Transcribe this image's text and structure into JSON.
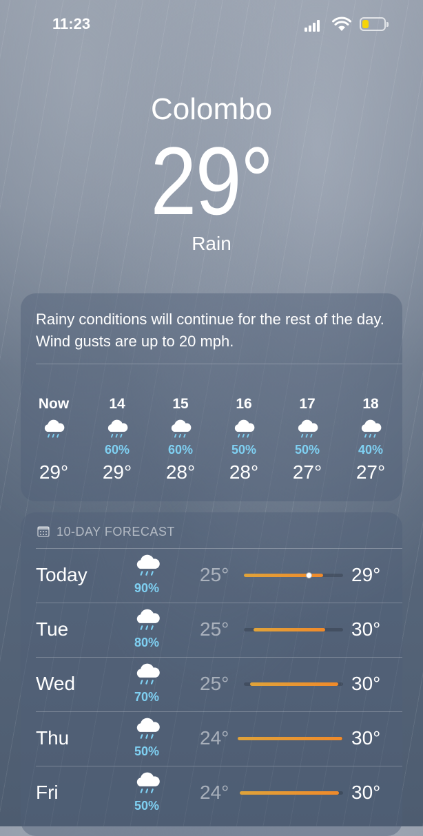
{
  "status_bar": {
    "time": "11:23"
  },
  "header": {
    "city": "Colombo",
    "temperature": "29°",
    "condition": "Rain"
  },
  "summary": {
    "text": "Rainy conditions will continue for the rest of the day. Wind gusts are up to 20 mph."
  },
  "hourly": [
    {
      "label": "Now",
      "icon": "rain-cloud-icon",
      "precip": "",
      "temp": "29°"
    },
    {
      "label": "14",
      "icon": "rain-cloud-icon",
      "precip": "60%",
      "temp": "29°"
    },
    {
      "label": "15",
      "icon": "rain-cloud-icon",
      "precip": "60%",
      "temp": "28°"
    },
    {
      "label": "16",
      "icon": "rain-cloud-icon",
      "precip": "50%",
      "temp": "28°"
    },
    {
      "label": "17",
      "icon": "rain-cloud-icon",
      "precip": "50%",
      "temp": "27°"
    },
    {
      "label": "18",
      "icon": "rain-cloud-icon",
      "precip": "40%",
      "temp": "27°"
    }
  ],
  "forecast": {
    "title": "10-DAY FORECAST",
    "days": [
      {
        "day": "Today",
        "icon": "rain-cloud-icon",
        "precip": "90%",
        "low": "25°",
        "high": "29°",
        "range_start": 0.0,
        "range_end": 0.8,
        "current_marker": 0.65
      },
      {
        "day": "Tue",
        "icon": "rain-cloud-icon",
        "precip": "80%",
        "low": "25°",
        "high": "30°",
        "range_start": 0.1,
        "range_end": 0.82
      },
      {
        "day": "Wed",
        "icon": "rain-cloud-icon",
        "precip": "70%",
        "low": "25°",
        "high": "30°",
        "range_start": 0.06,
        "range_end": 0.95
      },
      {
        "day": "Thu",
        "icon": "rain-cloud-icon",
        "precip": "50%",
        "low": "24°",
        "high": "30°",
        "range_start": -0.06,
        "range_end": 0.99
      },
      {
        "day": "Fri",
        "icon": "rain-cloud-icon",
        "precip": "50%",
        "low": "24°",
        "high": "30°",
        "range_start": -0.04,
        "range_end": 0.96
      }
    ]
  },
  "colors": {
    "precip": "#7fd0f2",
    "range_bar": "#f08a2a",
    "battery": "#f5d40a"
  }
}
